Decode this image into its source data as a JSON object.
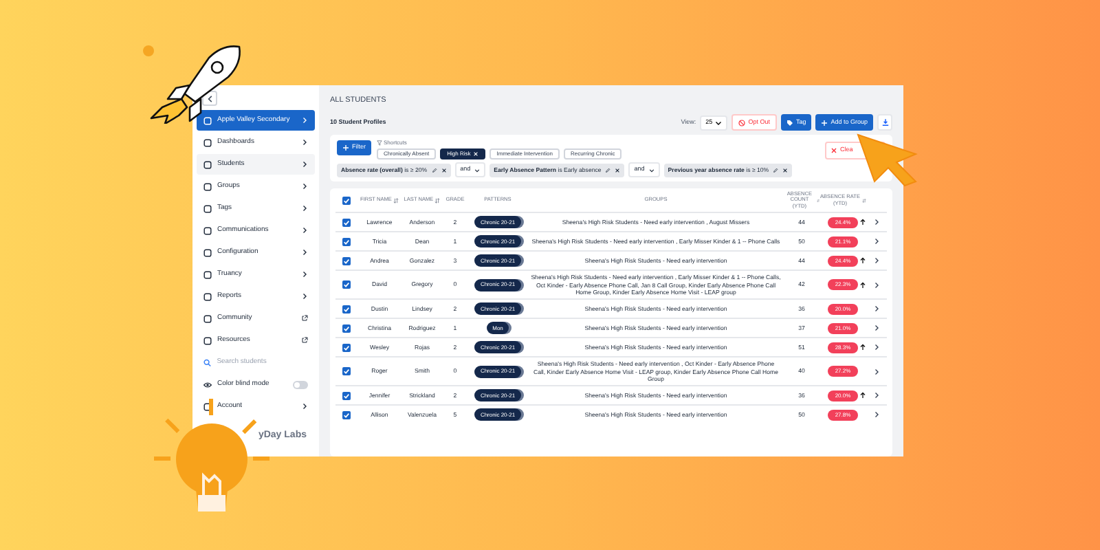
{
  "sidebar": {
    "items": [
      {
        "kind": "link",
        "label": "Apple Valley Secondary",
        "selected": true
      },
      {
        "kind": "link",
        "label": "Dashboards",
        "selected": false
      },
      {
        "kind": "link",
        "label": "Students",
        "selected": false,
        "highlighted": true
      },
      {
        "kind": "link",
        "label": "Groups",
        "selected": false
      },
      {
        "kind": "link",
        "label": "Tags",
        "selected": false
      },
      {
        "kind": "link",
        "label": "Communications",
        "selected": false
      },
      {
        "kind": "link",
        "label": "Configuration",
        "selected": false
      },
      {
        "kind": "link",
        "label": "Truancy",
        "selected": false
      },
      {
        "kind": "link",
        "label": "Reports",
        "selected": false
      },
      {
        "kind": "external",
        "label": "Community",
        "selected": false
      },
      {
        "kind": "external",
        "label": "Resources",
        "selected": false
      },
      {
        "kind": "search",
        "placeholder": "Search students"
      },
      {
        "kind": "toggle",
        "label": "Color blind mode",
        "on": false
      },
      {
        "kind": "link",
        "label": "Account",
        "selected": false
      }
    ],
    "logo": "yDay Labs"
  },
  "page_title": "ALL STUDENTS",
  "profile_count": "10 Student Profiles",
  "toolbar": {
    "view_label": "View:",
    "view_value": "25",
    "opt_out": "Opt Out",
    "tag": "Tag",
    "add_to_group": "Add to Group"
  },
  "filters": {
    "filter_button": "Filter",
    "shortcuts_label": "Shortcuts",
    "clear": "Clea",
    "shortcuts": [
      {
        "label": "Chronically Absent",
        "selected": false
      },
      {
        "label": "High Risk",
        "selected": true
      },
      {
        "label": "Immediate Intervention",
        "selected": false
      },
      {
        "label": "Recurring Chronic",
        "selected": false
      }
    ],
    "conditions": [
      {
        "kind": "condition",
        "text": "**Absence rate (overall)** is ≥ 20%"
      },
      {
        "kind": "joiner",
        "text": "and"
      },
      {
        "kind": "condition",
        "text": "**Early Absence Pattern** is Early absence"
      },
      {
        "kind": "joiner",
        "text": "and"
      },
      {
        "kind": "condition",
        "text": "**Previous year absence rate** is ≥ 10%"
      }
    ]
  },
  "table": {
    "all_checked": true,
    "columns": [
      "FIRST NAME",
      "LAST NAME",
      "GRADE",
      "PATTERNS",
      "GROUPS",
      "ABSENCE COUNT (YTD)",
      "ABSENCE RATE (YTD)"
    ],
    "rows": [
      {
        "checked": true,
        "first": "Lawrence",
        "last": "Anderson",
        "grade": "2",
        "pattern": "Chronic 20-21",
        "groups": "Sheena's High Risk Students - Need early intervention , August Missers",
        "count": "44",
        "rate": "24.4%",
        "trend_up": true
      },
      {
        "checked": true,
        "first": "Tricia",
        "last": "Dean",
        "grade": "1",
        "pattern": "Chronic 20-21",
        "groups": "Sheena's High Risk Students - Need early intervention , Early Misser Kinder & 1 -- Phone Calls",
        "count": "50",
        "rate": "21.1%",
        "trend_up": false
      },
      {
        "checked": true,
        "first": "Andrea",
        "last": "Gonzalez",
        "grade": "3",
        "pattern": "Chronic 20-21",
        "groups": "Sheena's High Risk Students - Need early intervention",
        "count": "44",
        "rate": "24.4%",
        "trend_up": true
      },
      {
        "checked": true,
        "first": "David",
        "last": "Gregory",
        "grade": "0",
        "pattern": "Chronic 20-21",
        "groups": "Sheena's High Risk Students - Need early intervention , Early Misser Kinder & 1 -- Phone Calls, Oct Kinder - Early Absence Phone Call, Jan 8 Call Group, Kinder Early Absence Phone Call Home Group, Kinder Early Absence Home Visit - LEAP group",
        "count": "42",
        "rate": "22.3%",
        "trend_up": true
      },
      {
        "checked": true,
        "first": "Dustin",
        "last": "Lindsey",
        "grade": "2",
        "pattern": "Chronic 20-21",
        "groups": "Sheena's High Risk Students - Need early intervention",
        "count": "36",
        "rate": "20.0%",
        "trend_up": false
      },
      {
        "checked": true,
        "first": "Christina",
        "last": "Rodriguez",
        "grade": "1",
        "pattern": "Mon",
        "groups": "Sheena's High Risk Students - Need early intervention",
        "count": "37",
        "rate": "21.0%",
        "trend_up": false
      },
      {
        "checked": true,
        "first": "Wesley",
        "last": "Rojas",
        "grade": "2",
        "pattern": "Chronic 20-21",
        "groups": "Sheena's High Risk Students - Need early intervention",
        "count": "51",
        "rate": "28.3%",
        "trend_up": true
      },
      {
        "checked": true,
        "first": "Roger",
        "last": "Smith",
        "grade": "0",
        "pattern": "Chronic 20-21",
        "groups": "Sheena's High Risk Students - Need early intervention , Oct Kinder - Early Absence Phone Call, Kinder Early Absence Home Visit - LEAP group, Kinder Early Absence Phone Call Home Group",
        "count": "40",
        "rate": "27.2%",
        "trend_up": false
      },
      {
        "checked": true,
        "first": "Jennifer",
        "last": "Strickland",
        "grade": "2",
        "pattern": "Chronic 20-21",
        "groups": "Sheena's High Risk Students - Need early intervention",
        "count": "36",
        "rate": "20.0%",
        "trend_up": true
      },
      {
        "checked": true,
        "first": "Allison",
        "last": "Valenzuela",
        "grade": "5",
        "pattern": "Chronic 20-21",
        "groups": "Sheena's High Risk Students - Need early intervention",
        "count": "50",
        "rate": "27.8%",
        "trend_up": false
      }
    ]
  }
}
